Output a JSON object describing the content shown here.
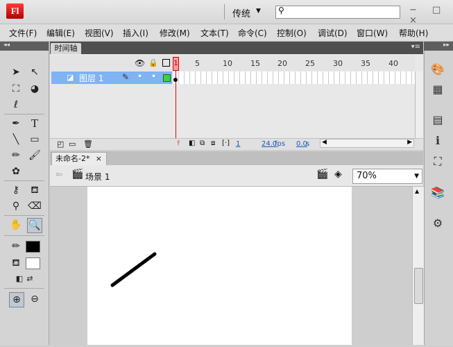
{
  "app": {
    "logo_text": "Fl",
    "workspace": "传统",
    "search_placeholder": ""
  },
  "window_buttons": "− □ ×",
  "menu": [
    "文件(F)",
    "编辑(E)",
    "视图(V)",
    "插入(I)",
    "修改(M)",
    "文本(T)",
    "命令(C)",
    "控制(O)",
    "调试(D)",
    "窗口(W)",
    "帮助(H)"
  ],
  "timeline": {
    "tab_label": "时间轴",
    "layer_name": "图层 1",
    "frame_ticks": [
      "1",
      "5",
      "10",
      "15",
      "20",
      "25",
      "30",
      "35",
      "40"
    ],
    "current_frame": "1",
    "fps": "24.0",
    "fps_unit": "fps",
    "time": "0.0",
    "time_unit": "s"
  },
  "document": {
    "tab_label": "未命名-2*",
    "close": "×",
    "scene_label": "场景 1",
    "zoom": "70%"
  },
  "colors": {
    "accent_blue": "#7fb3f1",
    "playhead_red": "#e00000",
    "stroke": "#000000",
    "fill": "#ffffff"
  },
  "tools": [
    "selection-icon",
    "subselection-icon",
    "free-transform-icon",
    "3d-rotation-icon",
    "lasso-icon",
    "pen-icon",
    "text-icon",
    "line-icon",
    "rectangle-icon",
    "pencil-icon",
    "brush-icon",
    "deco-icon",
    "bone-icon",
    "paint-bucket-icon",
    "eyedropper-icon",
    "eraser-icon",
    "hand-icon",
    "zoom-icon"
  ]
}
